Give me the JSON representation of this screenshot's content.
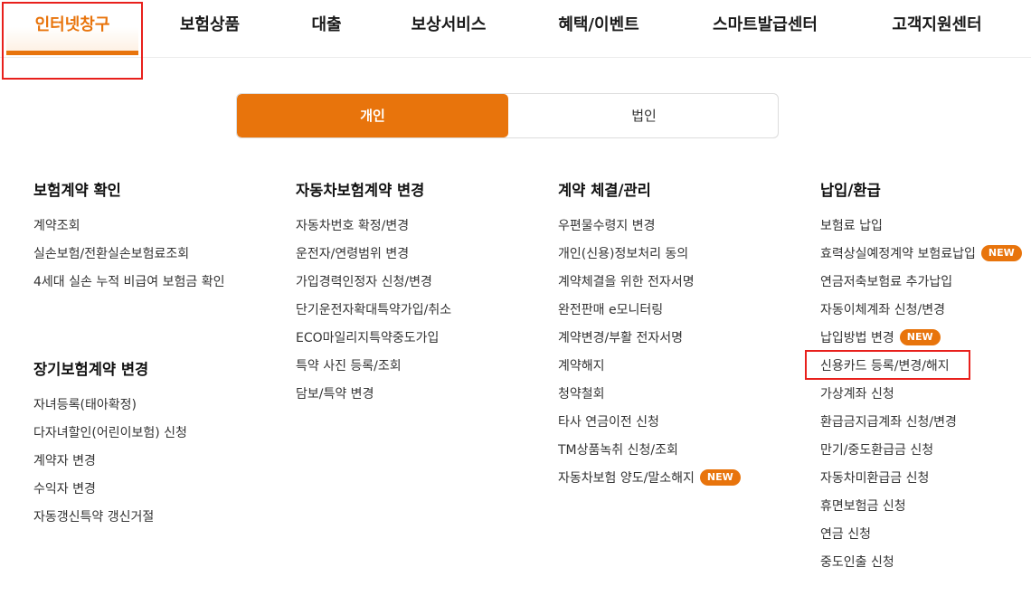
{
  "nav": {
    "items": [
      "인터넷창구",
      "보험상품",
      "대출",
      "보상서비스",
      "혜택/이벤트",
      "스마트발급센터",
      "고객지원센터"
    ],
    "active_index": 0
  },
  "toggle": {
    "options": [
      "개인",
      "법인"
    ],
    "selected": "개인"
  },
  "badge_label": "NEW",
  "columns": [
    {
      "groups": [
        {
          "title": "보험계약 확인",
          "items": [
            "계약조회",
            "실손보험/전환실손보험료조회",
            "4세대 실손 누적 비급여 보험금 확인"
          ]
        },
        {
          "title": "장기보험계약 변경",
          "items": [
            "자녀등록(태아확정)",
            "다자녀할인(어린이보험) 신청",
            "계약자 변경",
            "수익자 변경",
            "자동갱신특약 갱신거절"
          ]
        }
      ]
    },
    {
      "groups": [
        {
          "title": "자동차보험계약 변경",
          "items": [
            "자동차번호 확정/변경",
            "운전자/연령범위 변경",
            "가입경력인정자 신청/변경",
            "단기운전자확대특약가입/취소",
            "ECO마일리지특약중도가입",
            "특약 사진 등록/조회",
            "담보/특약 변경"
          ]
        }
      ]
    },
    {
      "groups": [
        {
          "title": "계약 체결/관리",
          "items": [
            "우편물수령지 변경",
            "개인(신용)정보처리 동의",
            "계약체결을 위한 전자서명",
            "완전판매 e모니터링",
            "계약변경/부활 전자서명",
            "계약해지",
            "청약철회",
            "타사 연금이전 신청",
            "TM상품녹취 신청/조회",
            "자동차보험 양도/말소해지"
          ]
        }
      ]
    },
    {
      "groups": [
        {
          "title": "납입/환급",
          "items": [
            "보험료 납입",
            "효력상실예정계약 보험료납입",
            "연금저축보험료 추가납입",
            "자동이체계좌 신청/변경",
            "납입방법 변경",
            "신용카드 등록/변경/해지",
            "가상계좌 신청",
            "환급금지급계좌 신청/변경",
            "만기/중도환급금 신청",
            "자동차미환급금 신청",
            "휴면보험금 신청",
            "연금 신청",
            "중도인출 신청"
          ]
        }
      ]
    }
  ]
}
